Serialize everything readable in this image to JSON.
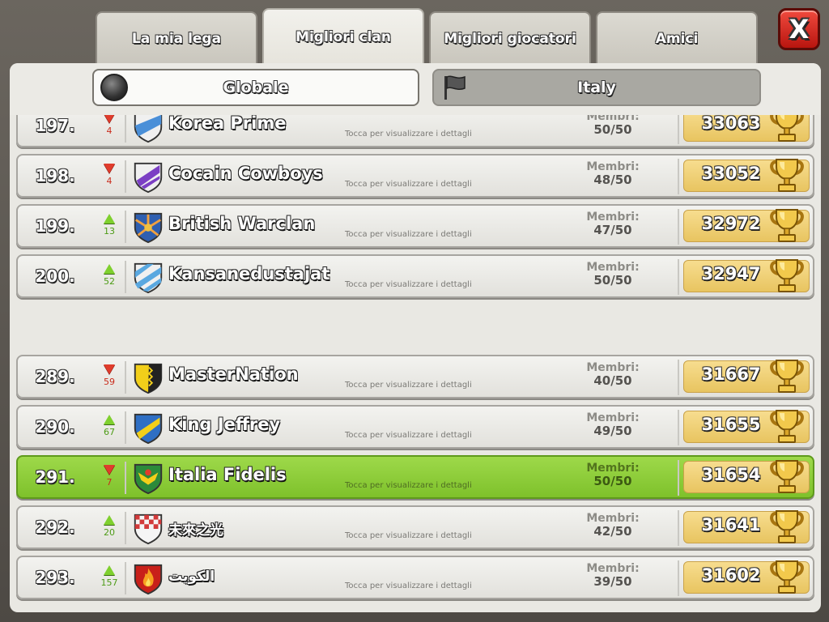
{
  "tabs": [
    {
      "label": "La mia lega",
      "active": false
    },
    {
      "label": "Migliori clan",
      "active": true
    },
    {
      "label": "Migliori giocatori",
      "active": false
    },
    {
      "label": "Amici",
      "active": false
    }
  ],
  "close_label": "X",
  "filters": {
    "global_label": "Globale",
    "country_label": "Italy",
    "selected": "Globale"
  },
  "members_label": "Membri:",
  "hint_text": "Tocca per visualizzare i dettagli",
  "colors": {
    "highlight": "#8ccd36",
    "trophy_gold": "#f2c94c",
    "up_arrow": "#7fd02e",
    "down_arrow": "#e03c2c"
  },
  "clans": [
    {
      "rank": "197.",
      "trend": "down",
      "change": "4",
      "name": "Korea Prime",
      "members": "50/50",
      "trophies": "33063",
      "badge": "blue-white-shield",
      "mine": false
    },
    {
      "rank": "198.",
      "trend": "down",
      "change": "4",
      "name": "Cocain Cowboys",
      "members": "48/50",
      "trophies": "33052",
      "badge": "purple-stripe-shield",
      "mine": false
    },
    {
      "rank": "199.",
      "trend": "up",
      "change": "13",
      "name": "British Warclan",
      "members": "47/50",
      "trophies": "32972",
      "badge": "orange-sunburst-shield",
      "mine": false
    },
    {
      "rank": "200.",
      "trend": "up",
      "change": "52",
      "name": "Kansanedustajat",
      "members": "50/50",
      "trophies": "32947",
      "badge": "blue-stripes-shield",
      "mine": false
    },
    {
      "rank": "289.",
      "trend": "down",
      "change": "59",
      "name": "MasterNation",
      "members": "40/50",
      "trophies": "31667",
      "badge": "yellow-black-shield",
      "mine": false
    },
    {
      "rank": "290.",
      "trend": "up",
      "change": "67",
      "name": "King Jeffrey",
      "members": "49/50",
      "trophies": "31655",
      "badge": "yellow-blue-shield",
      "mine": false
    },
    {
      "rank": "291.",
      "trend": "down",
      "change": "7",
      "name": "Italia Fidelis",
      "members": "50/50",
      "trophies": "31654",
      "badge": "green-eagle-shield",
      "mine": true
    },
    {
      "rank": "292.",
      "trend": "up",
      "change": "20",
      "name": "未來之光",
      "members": "42/50",
      "trophies": "31641",
      "badge": "red-checker-shield",
      "mine": false
    },
    {
      "rank": "293.",
      "trend": "up",
      "change": "157",
      "name": "الكويت",
      "members": "39/50",
      "trophies": "31602",
      "badge": "red-flame-shield",
      "mine": false
    }
  ]
}
